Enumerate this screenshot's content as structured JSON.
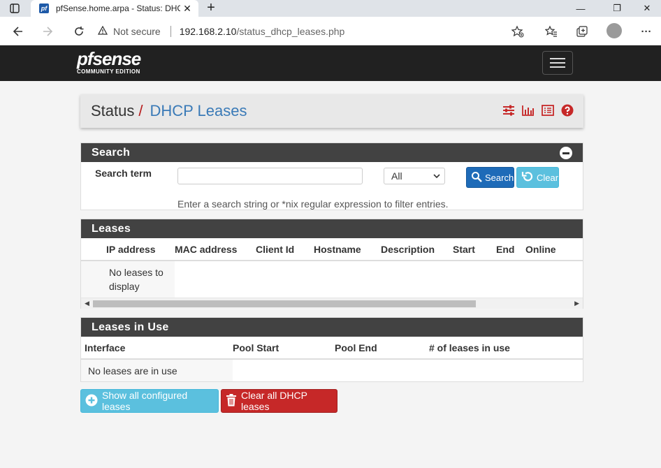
{
  "browser": {
    "tab_title": "pfSense.home.arpa - Status: DHC",
    "favicon_text": "pf",
    "close_glyph": "✕",
    "new_tab_glyph": "+",
    "security_label": "Not secure",
    "url_host": "192.168.2.10",
    "url_path": "/status_dhcp_leases.php",
    "window_controls": [
      "—",
      "❐",
      "✕"
    ],
    "menu_glyph": "···"
  },
  "navbar": {
    "logo_main": "pfsense",
    "logo_sub": "COMMUNITY EDITION"
  },
  "breadcrumb": {
    "section": "Status",
    "separator": "/",
    "page": "DHCP Leases",
    "icons": [
      "sliders-icon",
      "bar-chart-icon",
      "list-icon",
      "help-icon"
    ]
  },
  "search_panel": {
    "title": "Search",
    "term_label": "Search term",
    "input_value": "",
    "select_value": "All",
    "search_button": "Search",
    "clear_button": "Clear",
    "help_text": "Enter a search string or *nix regular expression to filter entries."
  },
  "leases_panel": {
    "title": "Leases",
    "columns": [
      "IP address",
      "MAC address",
      "Client Id",
      "Hostname",
      "Description",
      "Start",
      "End",
      "Online"
    ],
    "empty_text_line1": "No leases to",
    "empty_text_line2": "display"
  },
  "inuse_panel": {
    "title": "Leases in Use",
    "columns": [
      "Interface",
      "Pool Start",
      "Pool End",
      "# of leases in use"
    ],
    "empty_text": "No leases are in use"
  },
  "actions": {
    "show_all": "Show all configured leases",
    "clear_all": "Clear all DHCP leases"
  },
  "colors": {
    "navbar_bg": "#212121",
    "panel_head": "#424242",
    "primary": "#1e6bb8",
    "info": "#5bc0de",
    "danger": "#c62828",
    "link": "#3a7ab7"
  }
}
